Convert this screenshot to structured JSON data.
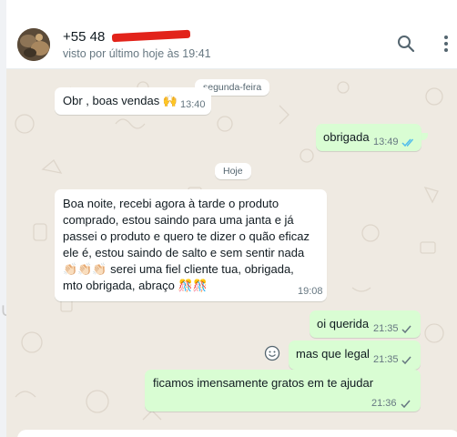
{
  "header": {
    "contact_name": "+55 48",
    "status": "visto por último hoje às 19:41"
  },
  "dates": {
    "monday": "segunda-feira",
    "today": "Hoje"
  },
  "messages": [
    {
      "dir": "in",
      "text": "Obr , boas vendas 🙌",
      "time": "13:40"
    },
    {
      "dir": "out",
      "text": "obrigada",
      "time": "13:49",
      "status": "read"
    },
    {
      "dir": "in",
      "lines": [
        "Boa noite, recebi agora à tarde o produto",
        "comprado, estou saindo para uma janta e já",
        "passei o produto e quero te dizer o quão eficaz",
        "ele é,  estou saindo de salto e sem sentir nada",
        "👏🏻👏🏻👏🏻  serei uma fiel cliente tua, obrigada,",
        "mto obrigada, abraço 🎊🎊"
      ],
      "time": "19:08"
    },
    {
      "dir": "out",
      "text": "oi querida",
      "time": "21:35",
      "status": "sent"
    },
    {
      "dir": "out",
      "text": "mas que legal",
      "time": "21:35",
      "status": "sent"
    },
    {
      "dir": "out",
      "text": "ficamos imensamente gratos em te ajudar",
      "time": "21:36",
      "status": "sent"
    }
  ],
  "colors": {
    "chat_bg": "#efeae2",
    "outgoing": "#d9fdd3",
    "incoming": "#ffffff",
    "read_tick": "#53bdeb",
    "sent_tick": "#667781",
    "redaction": "#e2231a"
  }
}
